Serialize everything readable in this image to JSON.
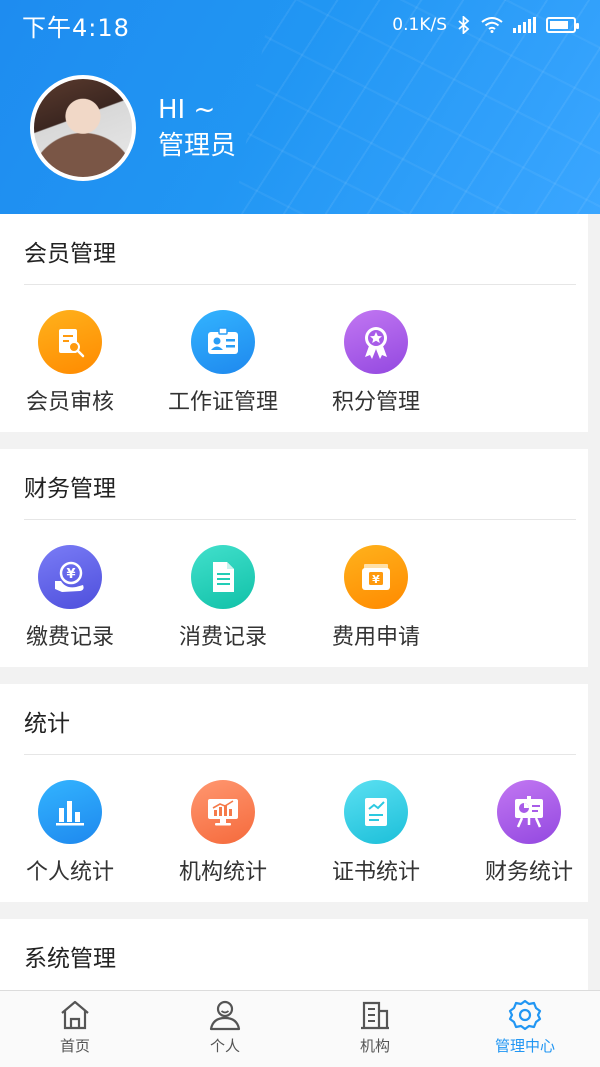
{
  "statusbar": {
    "time": "下午4:18",
    "speed": "0.1K/S"
  },
  "header": {
    "greeting": "HI ~",
    "username": "管理员"
  },
  "sections": [
    {
      "title": "会员管理",
      "items": [
        {
          "label": "会员审核",
          "icon": "document-search-icon",
          "color": "#ff9a0e"
        },
        {
          "label": "工作证管理",
          "icon": "id-card-icon",
          "color": "#2a9ef6"
        },
        {
          "label": "积分管理",
          "icon": "award-medal-icon",
          "color": "#a85ce8"
        }
      ]
    },
    {
      "title": "财务管理",
      "items": [
        {
          "label": "缴费记录",
          "icon": "yuan-hand-icon",
          "color": "#5f61e8"
        },
        {
          "label": "消费记录",
          "icon": "receipt-document-icon",
          "color": "#22cdb6"
        },
        {
          "label": "费用申请",
          "icon": "yuan-box-icon",
          "color": "#ff9a0e"
        }
      ]
    },
    {
      "title": "统计",
      "items": [
        {
          "label": "个人统计",
          "icon": "bar-chart-icon",
          "color": "#2a9ef6"
        },
        {
          "label": "机构统计",
          "icon": "monitor-chart-icon",
          "color": "#f57a4a"
        },
        {
          "label": "证书统计",
          "icon": "certificate-chart-icon",
          "color": "#2cc9e0"
        },
        {
          "label": "财务统计",
          "icon": "presentation-board-icon",
          "color": "#a85ce8"
        }
      ]
    },
    {
      "title": "系统管理",
      "items": []
    }
  ],
  "tabbar": [
    {
      "label": "首页",
      "icon": "home-icon",
      "active": false
    },
    {
      "label": "个人",
      "icon": "user-icon",
      "active": false
    },
    {
      "label": "机构",
      "icon": "building-icon",
      "active": false
    },
    {
      "label": "管理中心",
      "icon": "gear-icon",
      "active": true
    }
  ],
  "colors": {
    "primary": "#2196f3",
    "background": "#f2f2f2"
  }
}
